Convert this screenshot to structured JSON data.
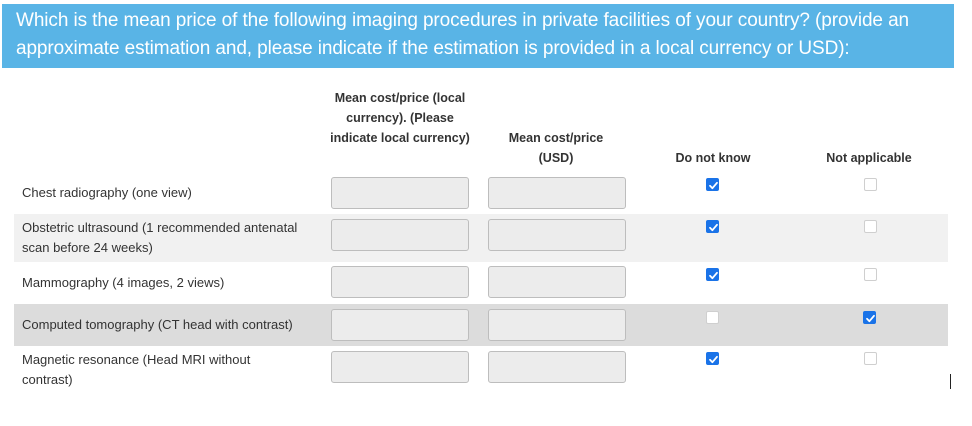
{
  "question": {
    "text": "Which is the mean price of the following imaging procedures in private facilities of your country? (provide an approximate estimation and, please indicate if the estimation is provided in a local currency or USD):"
  },
  "columns": {
    "local": "Mean cost/price (local currency). (Please indicate local currency)",
    "usd": "Mean cost/price (USD)",
    "dont_know": "Do not know",
    "not_applicable": "Not applicable"
  },
  "rows": [
    {
      "label": "Chest radiography (one view)",
      "local_value": "",
      "usd_value": "",
      "dont_know": true,
      "not_applicable": false
    },
    {
      "label": "Obstetric ultrasound (1 recommended antenatal scan before 24 weeks)",
      "local_value": "",
      "usd_value": "",
      "dont_know": true,
      "not_applicable": false
    },
    {
      "label": "Mammography (4 images, 2 views)",
      "local_value": "",
      "usd_value": "",
      "dont_know": true,
      "not_applicable": false
    },
    {
      "label": "Computed tomography (CT head with contrast)",
      "local_value": "",
      "usd_value": "",
      "dont_know": false,
      "not_applicable": true
    },
    {
      "label": "Magnetic resonance (Head MRI without contrast)",
      "local_value": "",
      "usd_value": "",
      "dont_know": true,
      "not_applicable": false
    }
  ],
  "colors": {
    "header_bg": "#59b4e6",
    "checkbox_checked": "#1a73e8",
    "row_alt_bg": "#f1f1f1",
    "row_selected_bg": "#dcdcdc"
  }
}
